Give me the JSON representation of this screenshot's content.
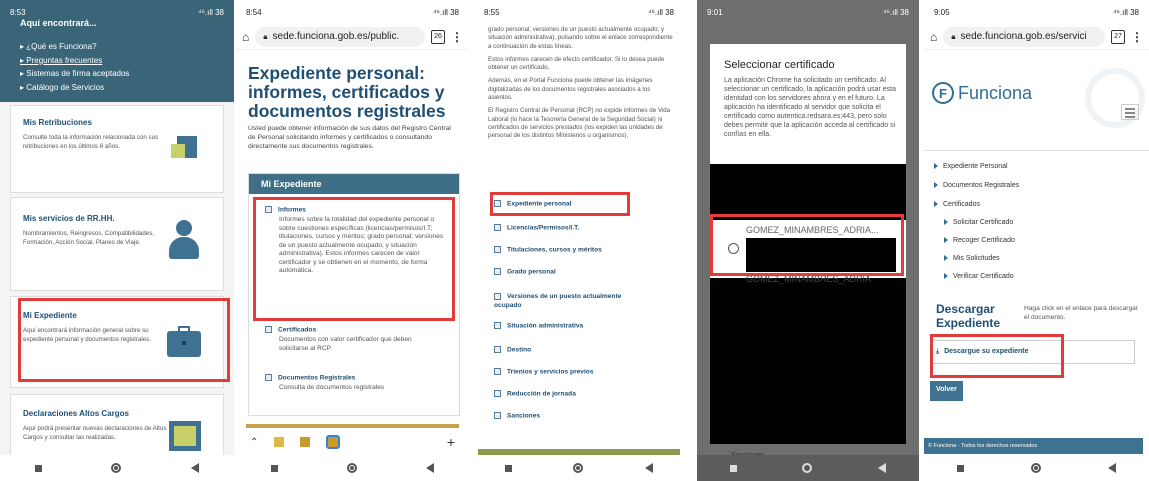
{
  "p1": {
    "time": "8:53",
    "signal": "⁴⁶.ıll 38",
    "header_title": "Aquí encontrará...",
    "links": [
      "¿Qué es Funciona?",
      "Preguntas frecuentes",
      "Sistemas de firma aceptados",
      "Catálogo de Servicios"
    ],
    "cards": [
      {
        "title": "Mis Retribuciones",
        "text": "Consulte toda la información relacionada con sus retribuciones en los últimos 6 años."
      },
      {
        "title": "Mis servicios de RR.HH.",
        "text": "Nombramientos, Reingresos, Compatibilidades, Formación, Acción Social, Planes de Viaje."
      },
      {
        "title": "Mi Expediente",
        "text": "Aquí encontrará información general sobre su expediente personal y documentos registrales."
      },
      {
        "title": "Declaraciones Altos Cargos",
        "text": "Aquí podrá presentar nuevas declaraciones de Altos Cargos y consultar las realizadas."
      }
    ]
  },
  "p2": {
    "time": "8:54",
    "signal": "⁴⁶.ıll 38",
    "url": "sede.funciona.gob.es/public.",
    "tab_count": "26",
    "title": "Expediente personal: informes, certificados y documentos registrales",
    "intro": "Usted puede obtener información de sus datos del Registro Central de Personal solicitando informes y certificados o consultando directamente sus documentos registrales.",
    "box_title": "Mi Expediente",
    "sections": [
      {
        "title": "Informes",
        "text": "Informes sobre la totalidad del expediente personal o sobre cuestiones específicas (licencias/permisos/I.T; titulaciones, cursos y méritos; grado personal; versiones de un puesto actualmente ocupado; y situación administrativa). Estos informes carecen de valor certificador y se obtienen en el momento, de forma automática."
      },
      {
        "title": "Certificados",
        "text": "Documentos con valor certificador que deben solicitarse al RCP."
      },
      {
        "title": "Documentos Registrales",
        "text": "Consulta de documentos registrales"
      }
    ],
    "plus": "+"
  },
  "p3": {
    "time": "8:55",
    "signal": "⁴⁶.ıll 38",
    "paras": [
      "grado personal; versiones de un puesto actualmente ocupado; y situación administrativa), pulsando sobre el enlace correspondiente a continuación de estas líneas.",
      "Estos informes carecen de efecto certificador. Si lo desea puede obtener un certificado.",
      "Además, en el Portal Funciona puede obtener las imágenes digitalizadas de los documentos registrales asociados a los asientos.",
      "El Registro Central de Personal (RCP) no expide informes de Vida Laboral (lo hace la Tesorería General de la Seguridad Social) ni certificados de servicios prestados (los expiden las unidades de personal de los distintos Ministerios u organismos)."
    ],
    "items": [
      "Expediente personal",
      "Licencias/Permisos/I.T.",
      "Titulaciones, cursos y méritos",
      "Grado personal",
      "Versiones de un puesto actualmente ocupado",
      "Situación administrativa",
      "Destino",
      "Trienios y servicios previos",
      "Reducción de jornada",
      "Sanciones"
    ]
  },
  "p4": {
    "time": "9:01",
    "signal": "⁴⁶.ıll 38",
    "title": "Seleccionar certificado",
    "text": "La aplicación Chrome ha solicitado un certificado. Al seleccionar un certificado, la aplicación podrá usar esta identidad con los servidores ahora y en el futuro. La aplicación ha identificado al servidor que solicita el certificado como autentica.redsara.es:443, pero solo debes permitir que la aplicación acceda al certificado si confías en ella.",
    "cert_name": "GOMEZ_MINAMBRES_ADRIA...",
    "cert_ghost": "GOMEZ_MINAMBRES_ADRIA",
    "bottom": "Sanciones"
  },
  "p5": {
    "time": "9:05",
    "signal": "⁴⁶.ıll 38",
    "url": "sede.funciona.gob.es/servici",
    "tab_count": "27",
    "logo": "Funciona",
    "nav": [
      {
        "label": "Expediente Personal",
        "level": 0
      },
      {
        "label": "Documentos Registrales",
        "level": 0
      },
      {
        "label": "Certificados",
        "level": 0
      },
      {
        "label": "Solicitar Certificado",
        "level": 1
      },
      {
        "label": "Recoger Certificado",
        "level": 1
      },
      {
        "label": "Mis Solicitudes",
        "level": 1
      },
      {
        "label": "Verificar Certificado",
        "level": 1
      }
    ],
    "dl_title": "Descargar Expediente",
    "dl_help": "Haga click en el enlace para descargar el documento.",
    "dl_link": "Descargue su expediente",
    "back": "Volver",
    "footer": "© Funciona - Todos los derechos reservados"
  },
  "colors": {
    "red": "#e23b3b",
    "navy": "#1f4f73",
    "teal": "#4a7a8c",
    "box_header": "#3f6f86"
  }
}
